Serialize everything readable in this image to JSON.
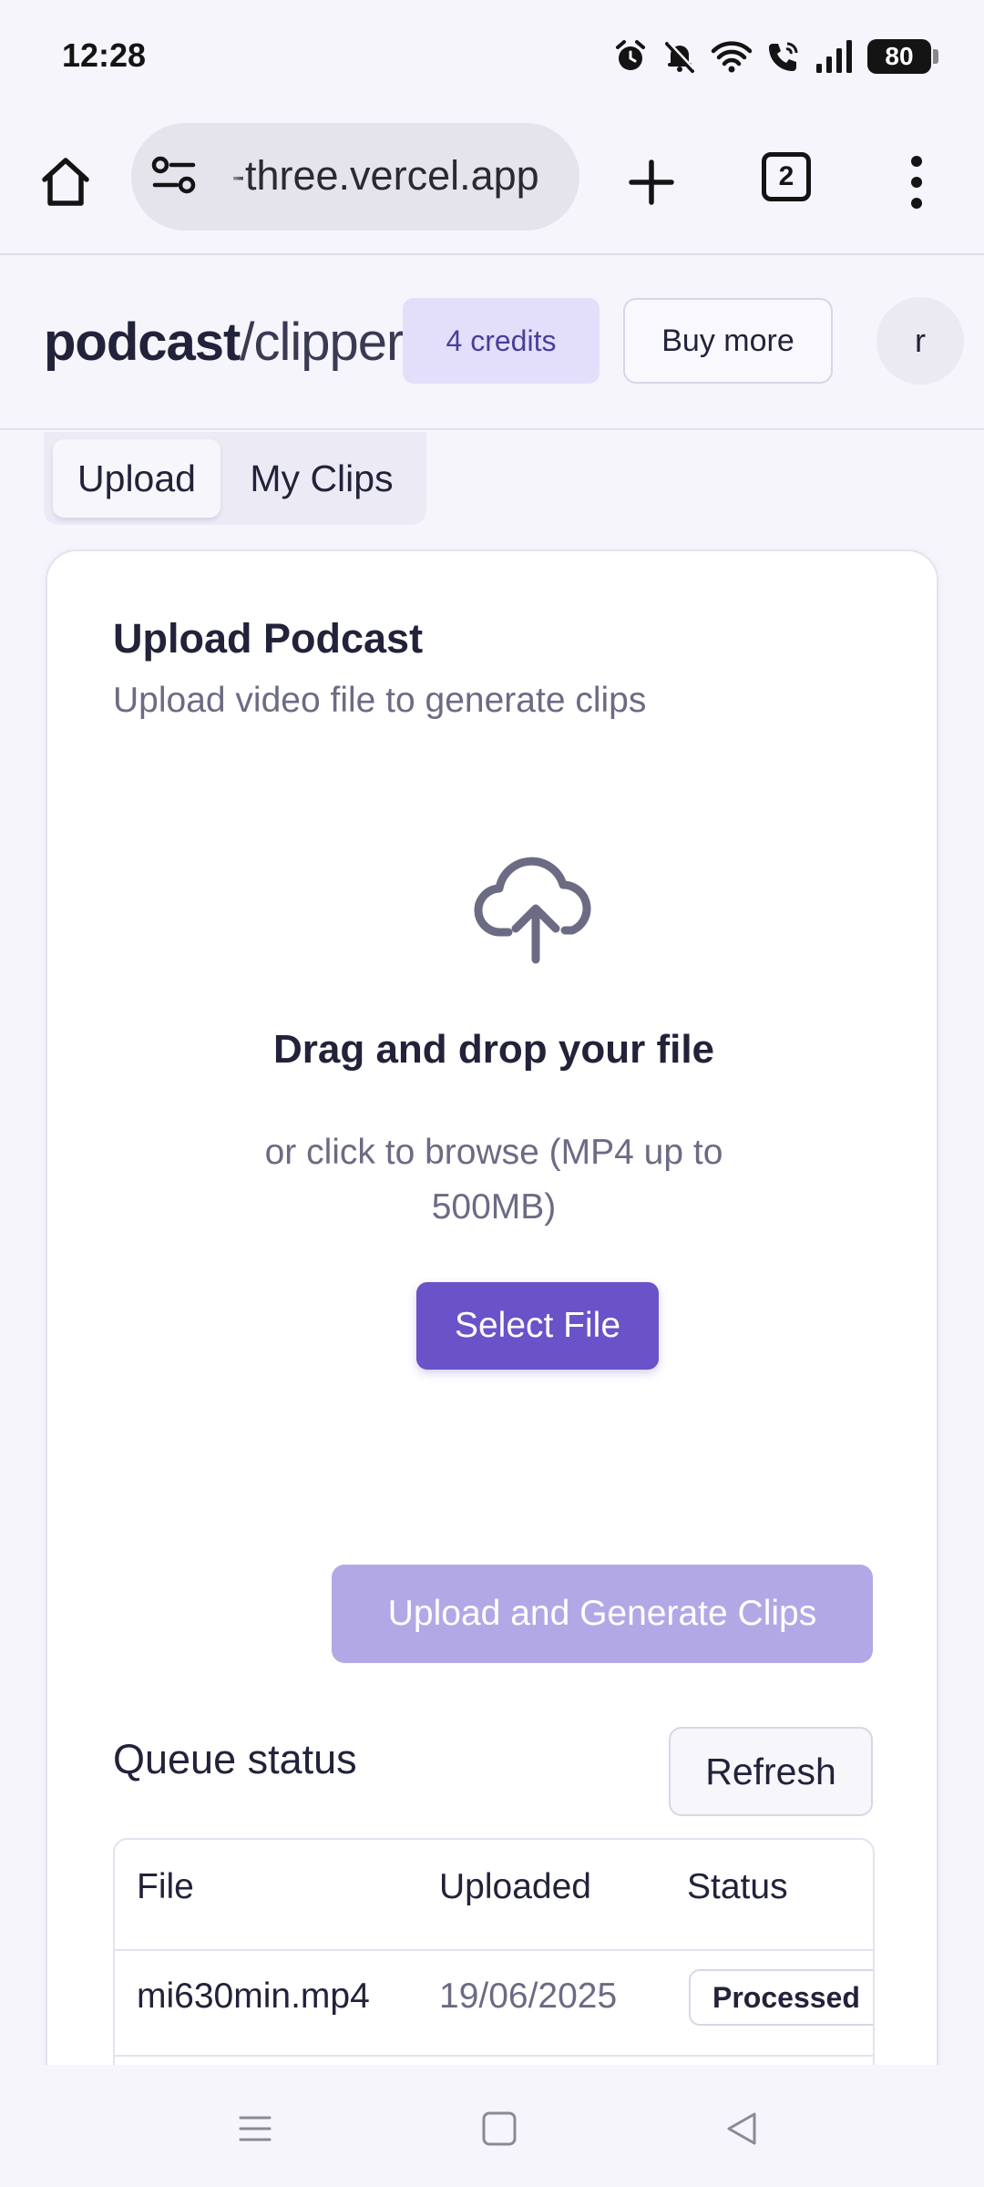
{
  "status_bar": {
    "time": "12:28",
    "battery": "80",
    "icons": [
      "alarm-icon",
      "bell-muted-icon",
      "wifi-icon",
      "wifi-call-icon",
      "signal-icon",
      "battery-icon"
    ]
  },
  "browser": {
    "url": "-three.vercel.app",
    "tab_count": "2",
    "icons": [
      "home-icon",
      "site-settings-icon",
      "new-tab-icon",
      "tabs-icon",
      "more-menu-icon"
    ]
  },
  "header": {
    "brand_bold": "podcast",
    "brand_rest": "/clipper",
    "credits": "4 credits",
    "buy_more": "Buy more",
    "avatar_initial": "r"
  },
  "tabs": [
    {
      "label": "Upload",
      "active": true
    },
    {
      "label": "My Clips",
      "active": false
    }
  ],
  "upload_card": {
    "title": "Upload Podcast",
    "subtitle": "Upload video file to generate clips",
    "dropzone_title": "Drag and drop your file",
    "dropzone_subtitle": "or click to browse (MP4 up to 500MB)",
    "select_file": "Select File",
    "upload_button": "Upload and Generate Clips"
  },
  "queue": {
    "title": "Queue status",
    "refresh": "Refresh",
    "columns": [
      "File",
      "Uploaded",
      "Status"
    ],
    "rows": [
      {
        "file": "mi630min.mp4",
        "uploaded": "19/06/2025",
        "status": "Processed"
      }
    ]
  },
  "colors": {
    "accent": "#6a52c9",
    "accent_disabled": "#b3a8e6",
    "credits_bg": "#e3dffb",
    "page_bg": "#f6f5fc"
  }
}
